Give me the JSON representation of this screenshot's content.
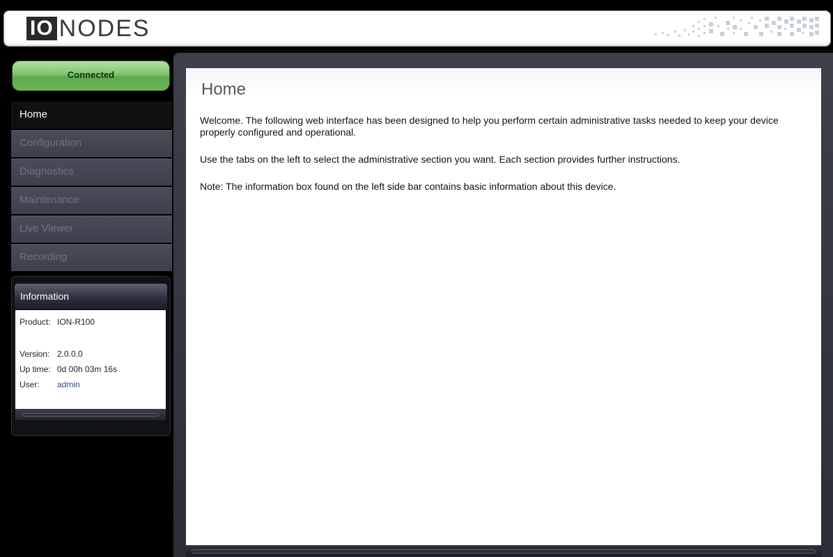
{
  "header": {
    "logo_io": "IO",
    "logo_nodes": "NODES"
  },
  "status": {
    "label": "Connected",
    "color": "#6eb65e"
  },
  "nav": {
    "items": [
      {
        "label": "Home",
        "active": true
      },
      {
        "label": "Configuration",
        "active": false
      },
      {
        "label": "Diagnostics",
        "active": false
      },
      {
        "label": "Maintenance",
        "active": false
      },
      {
        "label": "Live Viewer",
        "active": false
      },
      {
        "label": "Recording",
        "active": false
      }
    ]
  },
  "info": {
    "title": "Information",
    "product_label": "Product:",
    "product_value": "ION-R100",
    "version_label": "Version:",
    "version_value": "2.0.0.0",
    "uptime_label": "Up time:",
    "uptime_value": "0d 00h 03m 16s",
    "user_label": "User:",
    "user_value": "admin"
  },
  "main": {
    "title": "Home",
    "paragraphs": [
      "Welcome.  The following web interface has been designed to help you perform certain administrative tasks needed to keep your device properly configured and operational.",
      "Use the tabs on the left to select the administrative section you want.  Each section provides further instructions.",
      "Note: The information box found on the left side bar contains basic information about this device."
    ]
  }
}
